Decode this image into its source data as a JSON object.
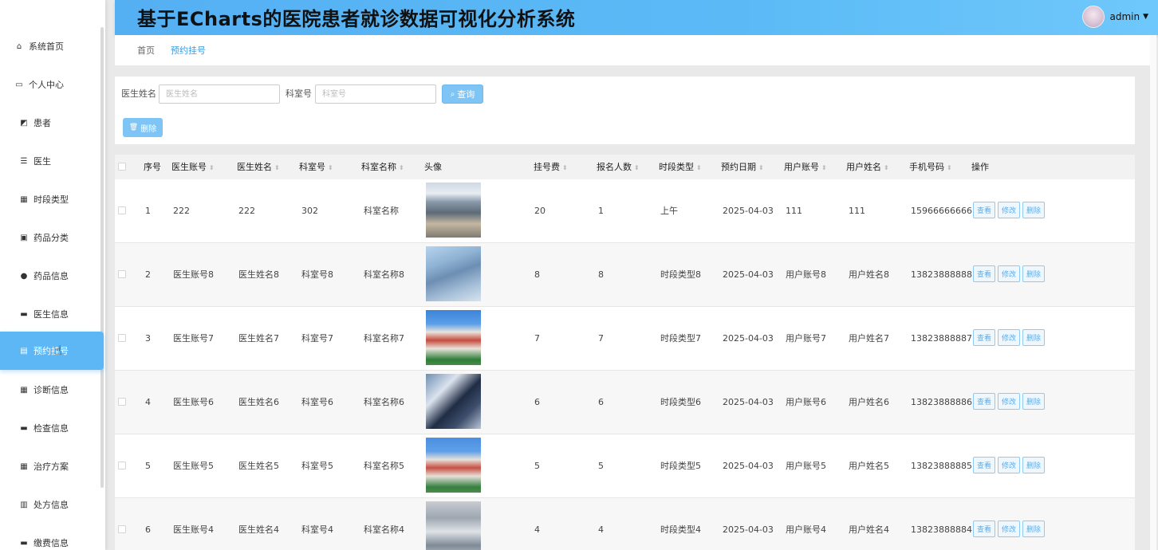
{
  "app": {
    "title": "基于ECharts的医院患者就诊数据可视化分析系统",
    "user": "admin"
  },
  "menu": [
    {
      "label": "系统首页",
      "icon": "home-icon",
      "level": "top",
      "glyph": "⌂"
    },
    {
      "label": "个人中心",
      "icon": "user-card-icon",
      "level": "top",
      "glyph": "▭"
    },
    {
      "label": "患者",
      "icon": "chart-icon",
      "level": "sub",
      "glyph": "◩"
    },
    {
      "label": "医生",
      "icon": "list-icon",
      "level": "sub",
      "glyph": "☰"
    },
    {
      "label": "时段类型",
      "icon": "grid-icon",
      "level": "sub",
      "glyph": "▦"
    },
    {
      "label": "药品分类",
      "icon": "box-icon",
      "level": "sub",
      "glyph": "▣"
    },
    {
      "label": "药品信息",
      "icon": "pin-icon",
      "level": "sub",
      "glyph": "●"
    },
    {
      "label": "医生信息",
      "icon": "message-icon",
      "level": "sub",
      "glyph": "▬"
    },
    {
      "label": "预约挂号",
      "icon": "clipboard-icon",
      "level": "sub",
      "glyph": "▤",
      "active": true
    },
    {
      "label": "诊断信息",
      "icon": "grid-icon",
      "level": "sub",
      "glyph": "▦"
    },
    {
      "label": "检查信息",
      "icon": "monitor-icon",
      "level": "sub",
      "glyph": "▬"
    },
    {
      "label": "治疗方案",
      "icon": "grid-icon",
      "level": "sub",
      "glyph": "▦"
    },
    {
      "label": "处方信息",
      "icon": "bar-chart-icon",
      "level": "sub",
      "glyph": "▥"
    },
    {
      "label": "缴费信息",
      "icon": "card-icon",
      "level": "sub",
      "glyph": "▬"
    }
  ],
  "breadcrumb": {
    "home": "首页",
    "current": "预约挂号"
  },
  "search": {
    "doctor_name_label": "医生姓名",
    "doctor_name_placeholder": "医生姓名",
    "dept_label": "科室号",
    "dept_placeholder": "科室号",
    "query_label": "查询",
    "delete_label": "删除"
  },
  "table": {
    "headers": [
      "序号",
      "医生账号",
      "医生姓名",
      "科室号",
      "科室名称",
      "头像",
      "挂号费",
      "报名人数",
      "时段类型",
      "预约日期",
      "用户账号",
      "用户姓名",
      "手机号码",
      "操作"
    ],
    "op_labels": {
      "view": "查看",
      "edit": "修改",
      "delete": "删除"
    },
    "rows": [
      {
        "no": "1",
        "doctor_account": "222",
        "doctor_name": "222",
        "dept_no": "302",
        "dept_name": "科室名称",
        "fee": "20",
        "count": "1",
        "period": "上午",
        "date": "2025-04-03",
        "user_account": "111",
        "user_name": "111",
        "phone": "15966666666"
      },
      {
        "no": "2",
        "doctor_account": "医生账号8",
        "doctor_name": "医生姓名8",
        "dept_no": "科室号8",
        "dept_name": "科室名称8",
        "fee": "8",
        "count": "8",
        "period": "时段类型8",
        "date": "2025-04-03",
        "user_account": "用户账号8",
        "user_name": "用户姓名8",
        "phone": "13823888888"
      },
      {
        "no": "3",
        "doctor_account": "医生账号7",
        "doctor_name": "医生姓名7",
        "dept_no": "科室号7",
        "dept_name": "科室名称7",
        "fee": "7",
        "count": "7",
        "period": "时段类型7",
        "date": "2025-04-03",
        "user_account": "用户账号7",
        "user_name": "用户姓名7",
        "phone": "13823888887"
      },
      {
        "no": "4",
        "doctor_account": "医生账号6",
        "doctor_name": "医生姓名6",
        "dept_no": "科室号6",
        "dept_name": "科室名称6",
        "fee": "6",
        "count": "6",
        "period": "时段类型6",
        "date": "2025-04-03",
        "user_account": "用户账号6",
        "user_name": "用户姓名6",
        "phone": "13823888886"
      },
      {
        "no": "5",
        "doctor_account": "医生账号5",
        "doctor_name": "医生姓名5",
        "dept_no": "科室号5",
        "dept_name": "科室名称5",
        "fee": "5",
        "count": "5",
        "period": "时段类型5",
        "date": "2025-04-03",
        "user_account": "用户账号5",
        "user_name": "用户姓名5",
        "phone": "13823888885"
      },
      {
        "no": "6",
        "doctor_account": "医生账号4",
        "doctor_name": "医生姓名4",
        "dept_no": "科室号4",
        "dept_name": "科室名称4",
        "fee": "4",
        "count": "4",
        "period": "时段类型4",
        "date": "2025-04-03",
        "user_account": "用户账号4",
        "user_name": "用户姓名4",
        "phone": "13823888884"
      }
    ]
  },
  "colors": {
    "accent": "#5db7f5",
    "header": "#55b0f3",
    "button": "#7ec5f5"
  }
}
